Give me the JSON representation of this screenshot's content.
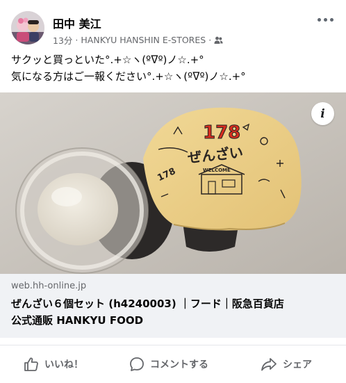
{
  "post": {
    "author": "田中 美江",
    "time": "13分",
    "source": "HANKYU HANSHIN E-STORES",
    "audience_icon": "friends-icon",
    "text_lines": [
      "サクッと買っといた°.+☆ヽ(ºᐁº)ノ☆.+°",
      "気になる方はご一報ください°.+☆ヽ(ºᐁº)ノ☆.+°"
    ]
  },
  "image": {
    "label_number": "178",
    "label_text": "ぜんざい",
    "label_small": "WELCOME",
    "info_symbol": "i"
  },
  "link": {
    "domain": "web.hh-online.jp",
    "title_lines": [
      "ぜんざい６個セット (h4240003) ｜フード｜阪急百貨店",
      "公式通販 HANKYU FOOD"
    ]
  },
  "actions": {
    "like": "いいね！",
    "comment": "コメントする",
    "share": "シェア"
  },
  "colors": {
    "text": "#050505",
    "secondary": "#65676b",
    "link_bg": "#f0f2f5",
    "divider": "#e4e6eb",
    "label_red": "#d62e1f"
  }
}
